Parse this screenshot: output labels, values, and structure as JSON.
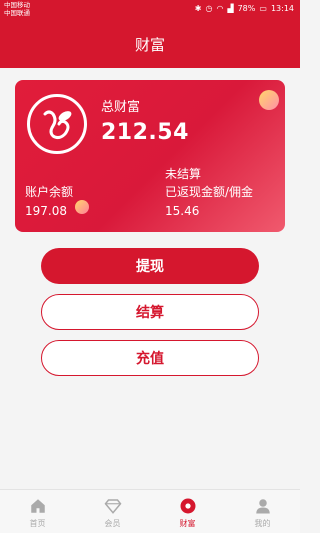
{
  "status_bar": {
    "carrier1": "中国移动",
    "carrier2": "中国联通",
    "battery": "78%",
    "time": "13:14"
  },
  "header": {
    "title": "财富"
  },
  "card": {
    "total_label": "总财富",
    "total_value": "212.54",
    "unsettled_label": "未结算",
    "balance_label": "账户余额",
    "balance_value": "197.08",
    "returned_label": "已返现金额/佣金",
    "returned_value": "15.46"
  },
  "actions": {
    "withdraw": "提现",
    "settle": "结算",
    "recharge": "充值"
  },
  "tabbar": {
    "items": [
      {
        "label": "首页",
        "icon": "home-icon"
      },
      {
        "label": "会员",
        "icon": "diamond-icon"
      },
      {
        "label": "财富",
        "icon": "wealth-icon"
      },
      {
        "label": "我的",
        "icon": "user-icon"
      }
    ],
    "active_index": 2
  },
  "colors": {
    "brand": "#d5172e"
  }
}
